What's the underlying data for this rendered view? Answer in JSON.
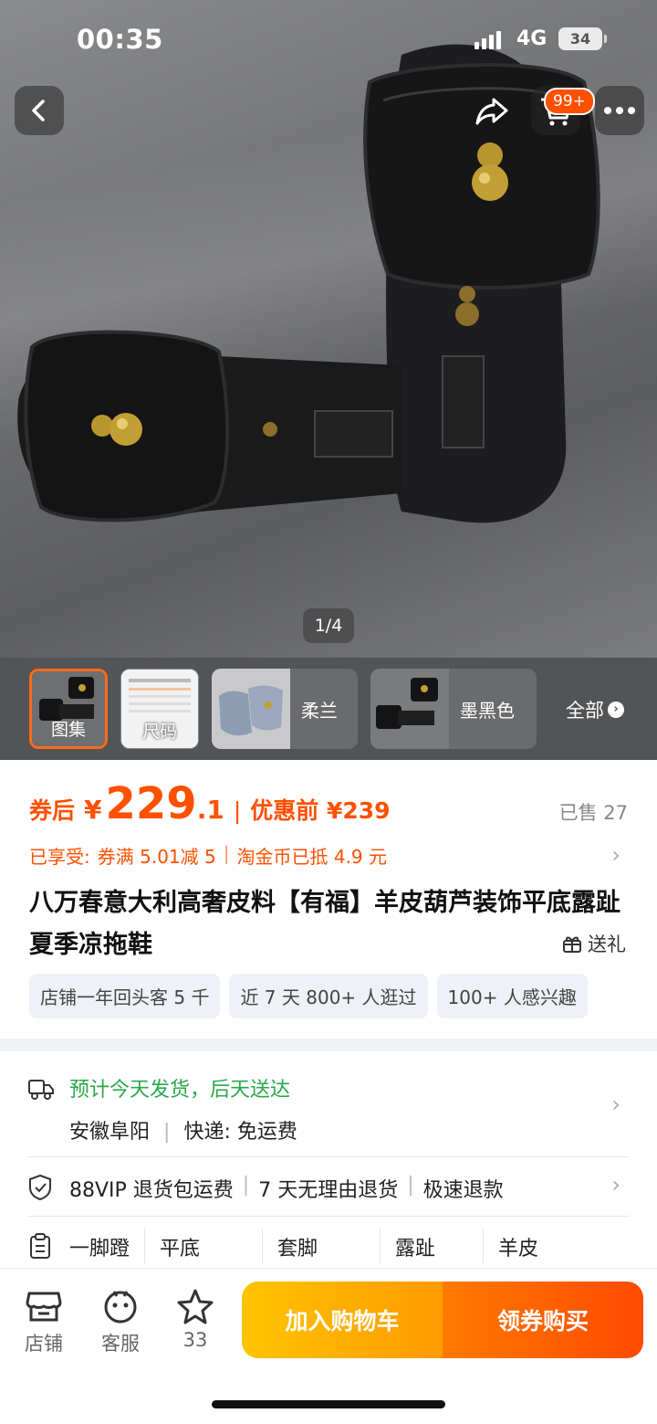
{
  "status_bar": {
    "time": "00:35",
    "network": "4G",
    "battery": "34"
  },
  "nav": {
    "cart_badge": "99+"
  },
  "gallery": {
    "counter": "1/4"
  },
  "thumbnails": [
    {
      "label": "图集"
    },
    {
      "label": "尺码"
    },
    {
      "label": "柔兰"
    },
    {
      "label": "墨黑色"
    }
  ],
  "thumbs_all_label": "全部",
  "price": {
    "label": "券后",
    "currency": "¥",
    "integer": "229",
    "decimal": ".1",
    "separator": "|",
    "pre_label": "优惠前 ¥239",
    "sold": "已售 27"
  },
  "promo": {
    "enjoyed": "已享受:",
    "coupon": "券满 5.01减 5",
    "divider": "|",
    "coins": "淘金币已抵 4.9 元"
  },
  "product": {
    "title": "八万春意大利高奢皮料【有福】羊皮葫芦装饰平底露趾夏季凉拖鞋",
    "gift_label": "送礼"
  },
  "tags": [
    "店铺一年回头客 5 千",
    "近 7 天 800+ 人逛过",
    "100+ 人感兴趣"
  ],
  "shipping": {
    "eta": "预计今天发货，后天送达",
    "origin": "安徽阜阳",
    "divider": "|",
    "delivery": "快递: 免运费"
  },
  "returns": [
    "88VIP 退货包运费",
    "7 天无理由退货",
    "极速退款"
  ],
  "returns_divider": "|",
  "attributes": [
    "一脚蹬",
    "平底",
    "套脚",
    "露趾",
    "羊皮"
  ],
  "bottom_bar": {
    "shop": "店铺",
    "service": "客服",
    "favorites_count": "33",
    "add_to_cart": "加入购物车",
    "buy_coupon": "领券购买"
  },
  "colors": {
    "accent": "#ff5000",
    "shipping_green": "#2aa84a",
    "cart_btn": "#ffb000",
    "buy_btn": "#ff5a00"
  }
}
